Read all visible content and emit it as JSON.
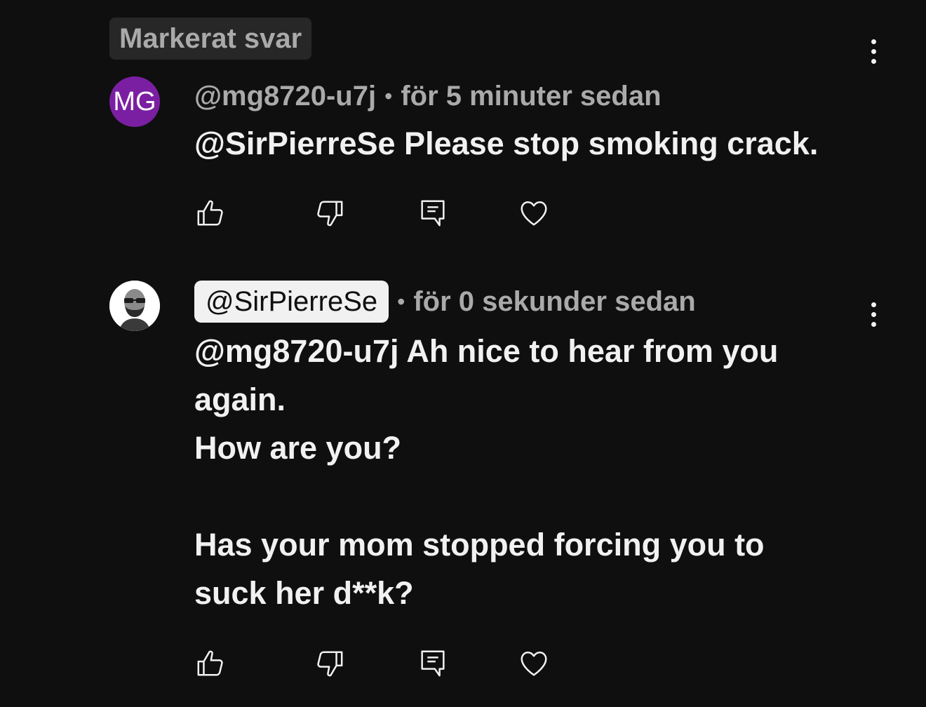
{
  "highlight_label": "Markerat svar",
  "comments": [
    {
      "avatar_initials": "MG",
      "avatar_color": "#7b1fa2",
      "author": "@mg8720-u7j",
      "separator": "•",
      "time": "för 5 minuter sedan",
      "text": "@SirPierreSe Please stop smoking crack."
    },
    {
      "avatar_icon": "profile-photo",
      "author": "@SirPierreSe",
      "separator": "•",
      "time": "för 0 sekunder sedan",
      "text": "@mg8720-u7j Ah nice to hear from you again.\nHow are you?\n\nHas your mom stopped forcing you to suck her d**k?"
    }
  ],
  "action_icons": [
    "thumb-up-icon",
    "thumb-down-icon",
    "reply-icon",
    "heart-icon"
  ],
  "colors": {
    "background": "#0f0f0f",
    "text_primary": "#f1f1f1",
    "text_secondary": "#aaaaaa",
    "badge_bg": "#272727"
  }
}
